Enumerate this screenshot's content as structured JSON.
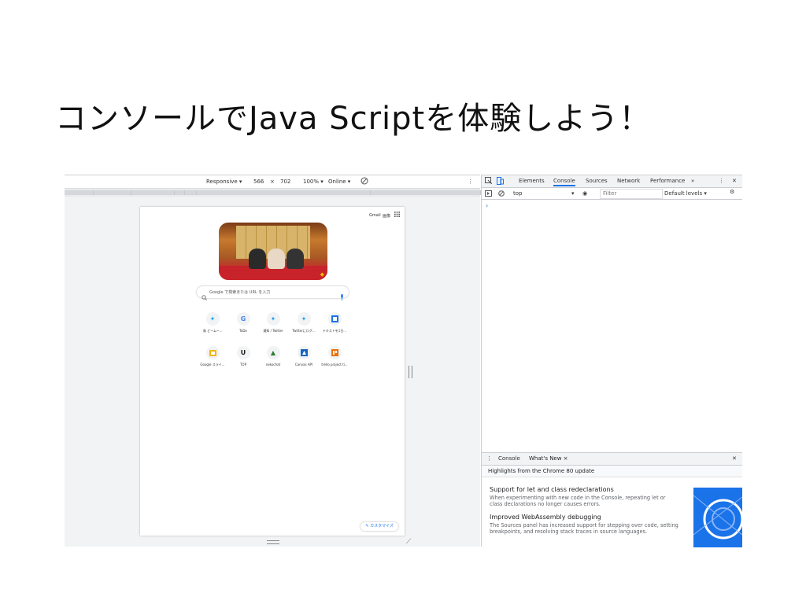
{
  "title": "コンソールでJava Scriptを体験しよう！",
  "device_toolbar": {
    "responsive": "Responsive ▾",
    "width": "566",
    "times": "×",
    "height": "702",
    "zoom": "100% ▾",
    "throttle": "Online ▾"
  },
  "google_page": {
    "gmail": "Gmail",
    "images": "画像",
    "search_placeholder": "Google で検索または URL を入力",
    "customize": "カスタマイズ",
    "shortcuts": [
      {
        "label": "鳥 どーム~...",
        "icon": "twitter-icon"
      },
      {
        "label": "ToDo",
        "icon": "google-g-icon"
      },
      {
        "label": "通知 / Twitter",
        "icon": "twitter-icon"
      },
      {
        "label": "Twitterにログ...",
        "icon": "twitter-icon"
      },
      {
        "label": "テキストを1日...",
        "icon": "square-link-icon"
      },
      {
        "label": "Google スライ...",
        "icon": "slides-icon"
      },
      {
        "label": "TOP",
        "icon": "u-logo-icon"
      },
      {
        "label": "nekochat",
        "icon": "mountain-icon"
      },
      {
        "label": "Canvas API",
        "icon": "mdn-icon"
      },
      {
        "label": "trello project ti...",
        "icon": "trello-icon"
      }
    ]
  },
  "devtools": {
    "tabs": [
      "Elements",
      "Console",
      "Sources",
      "Network",
      "Performance",
      "»"
    ],
    "active_tab": "Console",
    "context": "top",
    "filter_placeholder": "Filter",
    "levels": "Default levels ▾",
    "prompt": "›",
    "drawer": {
      "tabs": [
        "Console",
        "What's New ×"
      ],
      "highlights": "Highlights from the Chrome 80 update",
      "items": [
        {
          "title": "Support for let and class redeclarations",
          "desc": "When experimenting with new code in the Console, repeating let or class declarations no longer causes errors."
        },
        {
          "title": "Improved WebAssembly debugging",
          "desc": "The Sources panel has increased support for stepping over code, setting breakpoints, and resolving stack traces in source languages."
        }
      ]
    }
  },
  "colors": {
    "accent": "#1a73e8",
    "twitter": "#1da1f2"
  }
}
